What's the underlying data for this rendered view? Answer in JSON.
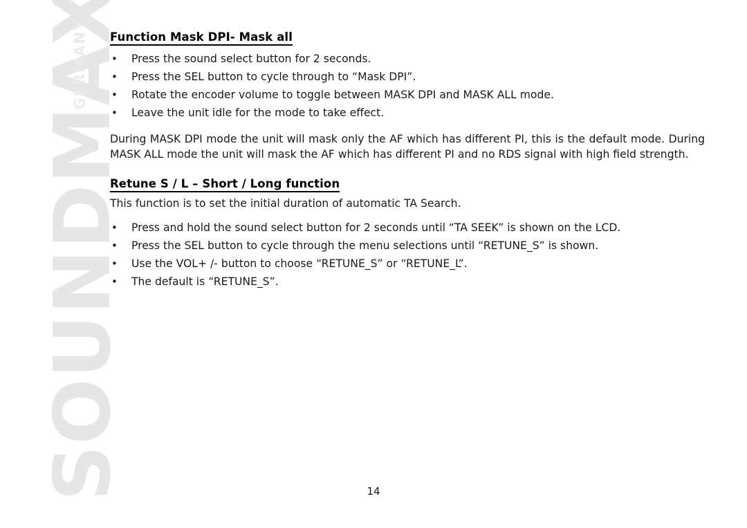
{
  "watermark": {
    "brand": "SOUNDMAX",
    "country": "GERMANY",
    "color": "#e6e6e6"
  },
  "document": {
    "sections": [
      {
        "heading": "Function Mask DPI- Mask all",
        "bullets": [
          "Press the sound select button for 2 seconds.",
          "Press the SEL button to cycle through to “Mask DPI”.",
          "Rotate the encoder volume to toggle between MASK DPI and MASK ALL mode.",
          "Leave the unit idle for the mode to take effect."
        ],
        "paragraph": "During MASK DPI mode the unit will mask only the AF which has different PI, this is the default mode. During MASK ALL mode the unit will mask the AF which has different PI and no RDS signal with high field strength."
      },
      {
        "heading": "Retune S / L – Short / Long function",
        "intro": "This function is to set the initial duration of automatic TA Search.",
        "bullets": [
          "Press and hold the sound select button for 2 seconds until “TA SEEK” is shown on the LCD.",
          "Press the SEL button to cycle through the menu selections until “RETUNE_S” is shown.",
          "Use the VOL+ /- button to choose “RETUNE_S” or “RETUNE_L”.",
          "The default is “RETUNE_S”."
        ]
      }
    ]
  },
  "footer": {
    "page_number": "14"
  },
  "bullet_glyph": "•"
}
